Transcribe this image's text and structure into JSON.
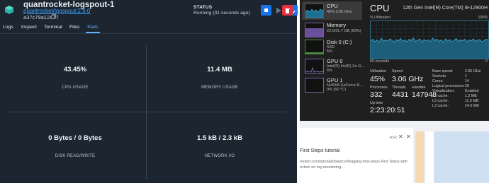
{
  "docker": {
    "container_name": "quantrocket-logspout-1",
    "image": "quantrocket/logspout:2.9.0",
    "container_id": "a37c79a12ad7",
    "status_label": "STATUS",
    "status_value": "Running (31 seconds ago)",
    "tabs": [
      "Logs",
      "Inspect",
      "Terminal",
      "Files",
      "Stats"
    ],
    "active_tab": "Stats",
    "stats": {
      "cpu_value": "43.45%",
      "cpu_label": "CPU USAGE",
      "mem_value": "11.4 MB",
      "mem_label": "MEMORY USAGE",
      "disk_value": "0 Bytes / 0 Bytes",
      "disk_label": "DISK READ/WRITE",
      "net_value": "1.5 kB / 2.3 kB",
      "net_label": "NETWORK I/O"
    },
    "colors": {
      "bg": "#1c2530",
      "accent": "#1a73e8",
      "danger": "#e5303b",
      "link": "#3aa0ff"
    }
  },
  "taskmgr": {
    "sidebar": [
      {
        "name": "CPU",
        "sub": "45% 3.06 GHz"
      },
      {
        "name": "Memory",
        "sub": "22.0/31.7 GB (69%)"
      },
      {
        "name": "Disk 0 (C:)",
        "sub": "SSD",
        "sub2": "5%"
      },
      {
        "name": "GPU 0",
        "sub": "Intel(R) Iris(R) Xe G...",
        "sub2": "6%"
      },
      {
        "name": "GPU 1",
        "sub": "NVIDIA GeForce R...",
        "sub2": "0% (50 °C)"
      }
    ],
    "title": "CPU",
    "model": "12th Gen Intel(R) Core(TM) i9-12900H",
    "util_label": "% Utilization",
    "util_max": "100%",
    "time_label": "60 seconds",
    "time_min": "0",
    "utilization_label": "Utilization",
    "utilization": "45%",
    "speed_label": "Speed",
    "speed": "3.06 GHz",
    "processes_label": "Processes",
    "processes": "332",
    "threads_label": "Threads",
    "threads": "4431",
    "handles_label": "Handles",
    "handles": "147948",
    "uptime_label": "Up time",
    "uptime": "2:23:20:51",
    "specs": [
      {
        "k": "Base speed:",
        "v": "2.90 GHz"
      },
      {
        "k": "Sockets:",
        "v": "1"
      },
      {
        "k": "Cores:",
        "v": "14"
      },
      {
        "k": "Logical processors:",
        "v": "20"
      },
      {
        "k": "Virtualization:",
        "v": "Enabled"
      },
      {
        "k": "L1 cache:",
        "v": "1.2 MB"
      },
      {
        "k": "L2 cache:",
        "v": "11.5 MB"
      },
      {
        "k": "L3 cache:",
        "v": "24.0 MB"
      }
    ],
    "cpu_history_pct": [
      48,
      52,
      45,
      50,
      44,
      55,
      47,
      50,
      46,
      53,
      49,
      44,
      51,
      47,
      54,
      46,
      50,
      45,
      52,
      48,
      55,
      46,
      49,
      53,
      44,
      51,
      47,
      50,
      45,
      55,
      48,
      52,
      46,
      50,
      44,
      53,
      47,
      51,
      45,
      49,
      54,
      46,
      50,
      48,
      52,
      45,
      50,
      47,
      53,
      46,
      49,
      51,
      45,
      48,
      52,
      50
    ]
  },
  "browser": {
    "esc_label": "esc",
    "close_glyph": "✕",
    "title": "First Steps tutorial",
    "url": "rocket.com/tutorials/basics/#logging-first-steps First Steps with",
    "desc": "ection on log monitoring..."
  }
}
